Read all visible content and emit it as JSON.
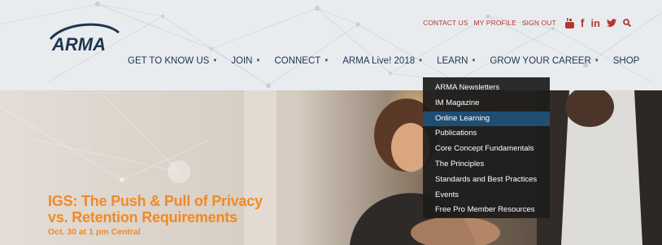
{
  "utility_links": [
    "CONTACT US",
    "MY PROFILE",
    "SIGN OUT"
  ],
  "social_icons": [
    "youtube-icon",
    "facebook-icon",
    "linkedin-icon",
    "twitter-icon",
    "search-icon"
  ],
  "social_glyphs": {
    "facebook": "f",
    "linkedin": "in"
  },
  "logo_text": "ARMA",
  "nav": [
    {
      "label": "GET TO KNOW US",
      "caret": "▼"
    },
    {
      "label": "JOIN",
      "caret": "▼"
    },
    {
      "label": "CONNECT",
      "caret": "▼"
    },
    {
      "label": "ARMA Live! 2018",
      "caret": "▼"
    },
    {
      "label": "LEARN",
      "caret": "▼"
    },
    {
      "label": "GROW YOUR CAREER",
      "caret": "▼"
    },
    {
      "label": "SHOP",
      "caret": ""
    }
  ],
  "dropdown": {
    "items": [
      "ARMA Newsletters",
      "IM Magazine",
      "Online Learning",
      "Publications",
      "Core Concept Fundamentals",
      "The Principles",
      "Standards and Best Practices",
      "Events",
      "Free Pro Member Resources"
    ],
    "active_item": "Online Learning"
  },
  "hero": {
    "title_line1": "IGS: The Push & Pull of Privacy",
    "title_line2": "vs. Retention Requirements",
    "subtitle": "Oct. 30 at 1 pm Central"
  },
  "colors": {
    "accent_red": "#b2382f",
    "nav_text": "#1e3550",
    "hero_orange": "#f08a24",
    "dropdown_bg": "#1c1c1c",
    "dropdown_active": "#1f4e73"
  }
}
